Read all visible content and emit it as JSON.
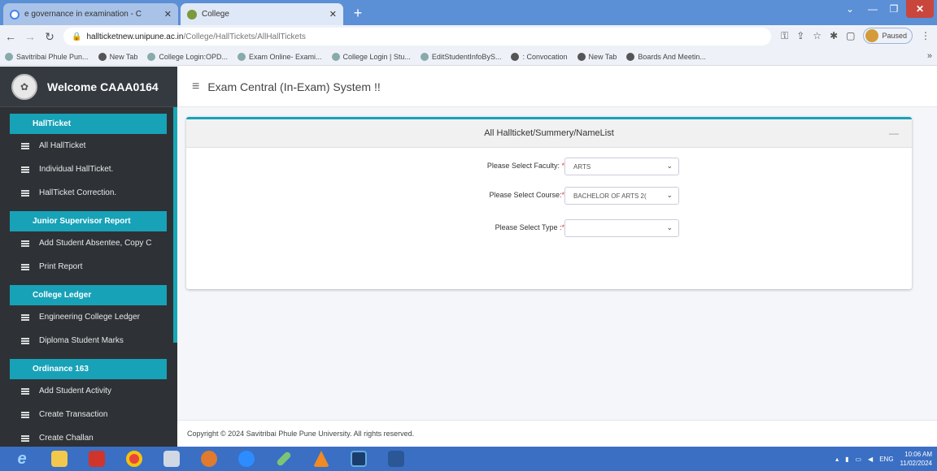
{
  "browser": {
    "tabs": [
      {
        "title": "e governance in examination - C",
        "active": false
      },
      {
        "title": "College",
        "active": true
      }
    ],
    "url_host": "hallticketnew.unipune.ac.in",
    "url_path": "/College/HallTickets/AllHallTickets",
    "profile_label": "Paused",
    "bookmarks": [
      "Savitribai Phule Pun...",
      "New Tab",
      "College Login:OPD...",
      "Exam Online- Exami...",
      "College Login | Stu...",
      "EditStudentInfoByS...",
      ": Convocation",
      "New Tab",
      "Boards And Meetin..."
    ]
  },
  "sidebar": {
    "welcome": "Welcome CAAA0164",
    "sections": [
      {
        "label": "HallTicket",
        "items": [
          "All HallTicket",
          "Individual HallTicket.",
          "HallTicket Correction."
        ]
      },
      {
        "label": "Junior Supervisor Report",
        "items": [
          "Add Student Absentee, Copy C",
          "Print Report"
        ]
      },
      {
        "label": "College Ledger",
        "items": [
          "Engineering College Ledger",
          "Diploma Student Marks"
        ]
      },
      {
        "label": "Ordinance 163",
        "items": [
          "Add Student Activity",
          "Create Transaction",
          "Create Challan"
        ]
      }
    ]
  },
  "header": {
    "menu_icon": "≡",
    "title": "Exam Central (In-Exam) System !!"
  },
  "card": {
    "title": "All Hallticket/Summery/NameList",
    "collapse_symbol": "—",
    "fields": [
      {
        "label": "Please Select Faculty:",
        "required": "*",
        "value": "ARTS"
      },
      {
        "label": "Please Select Course:",
        "required": "*",
        "value": "BACHELOR OF ARTS 2("
      },
      {
        "label": "Please Select Type :",
        "required": "*",
        "value": ""
      }
    ]
  },
  "footer": {
    "copyright": "Copyright © 2024 Savitribai Phule Pune University. All rights reserved."
  },
  "taskbar": {
    "tray_lang": "ENG",
    "time": "10:06 AM",
    "date": "11/02/2024"
  },
  "colors": {
    "accent": "#17a2b8",
    "sidebar_bg": "#2e3236",
    "tab_strip": "#5b8fd6",
    "taskbar": "#3a6fc4"
  }
}
